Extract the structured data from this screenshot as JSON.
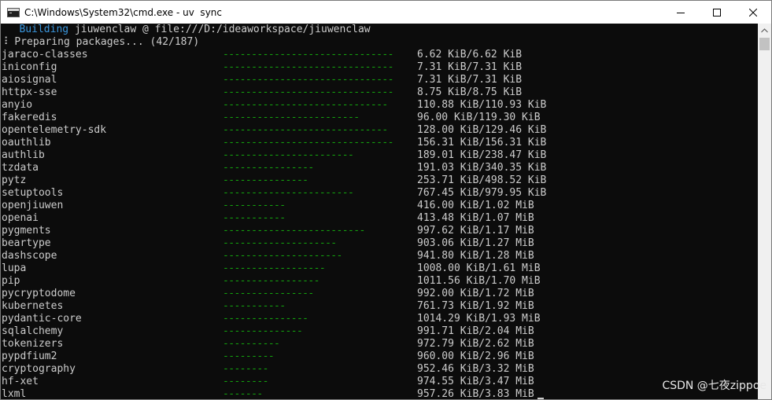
{
  "window": {
    "title": "C:\\Windows\\System32\\cmd.exe - uv  sync",
    "icon": "cmd-icon",
    "controls": [
      "minimize-icon",
      "maximize-icon",
      "close-icon"
    ]
  },
  "console": {
    "header": {
      "building_label": "Building",
      "building_target": "jiuwenclaw @ file:///D:/ideaworkspace/jiuwenclaw",
      "preparing": "⠸ Preparing packages... (42/187)"
    },
    "packages": [
      {
        "name": "jaraco-classes",
        "progress": 1.0,
        "size": "6.62 KiB/6.62 KiB"
      },
      {
        "name": "iniconfig",
        "progress": 1.0,
        "size": "7.31 KiB/7.31 KiB"
      },
      {
        "name": "aiosignal",
        "progress": 1.0,
        "size": "7.31 KiB/7.31 KiB"
      },
      {
        "name": "httpx-sse",
        "progress": 1.0,
        "size": "8.75 KiB/8.75 KiB"
      },
      {
        "name": "anyio",
        "progress": 0.97,
        "size": "110.88 KiB/110.93 KiB"
      },
      {
        "name": "fakeredis",
        "progress": 0.8,
        "size": "96.00 KiB/119.30 KiB"
      },
      {
        "name": "opentelemetry-sdk",
        "progress": 0.97,
        "size": "128.00 KiB/129.46 KiB"
      },
      {
        "name": "oauthlib",
        "progress": 1.0,
        "size": "156.31 KiB/156.31 KiB"
      },
      {
        "name": "authlib",
        "progress": 0.77,
        "size": "189.01 KiB/238.47 KiB"
      },
      {
        "name": "tzdata",
        "progress": 0.53,
        "size": "191.03 KiB/340.35 KiB"
      },
      {
        "name": "pytz",
        "progress": 0.5,
        "size": "253.71 KiB/498.52 KiB"
      },
      {
        "name": "setuptools",
        "progress": 0.77,
        "size": "767.45 KiB/979.95 KiB"
      },
      {
        "name": "openjiuwen",
        "progress": 0.37,
        "size": "416.00 KiB/1.02 MiB"
      },
      {
        "name": "openai",
        "progress": 0.37,
        "size": "413.48 KiB/1.07 MiB"
      },
      {
        "name": "pygments",
        "progress": 0.83,
        "size": "997.62 KiB/1.17 MiB"
      },
      {
        "name": "beartype",
        "progress": 0.67,
        "size": "903.06 KiB/1.27 MiB"
      },
      {
        "name": "dashscope",
        "progress": 0.7,
        "size": "941.80 KiB/1.28 MiB"
      },
      {
        "name": "lupa",
        "progress": 0.6,
        "size": "1008.00 KiB/1.61 MiB"
      },
      {
        "name": "pip",
        "progress": 0.57,
        "size": "1011.56 KiB/1.70 MiB"
      },
      {
        "name": "pycryptodome",
        "progress": 0.53,
        "size": "992.00 KiB/1.72 MiB"
      },
      {
        "name": "kubernetes",
        "progress": 0.37,
        "size": "761.73 KiB/1.92 MiB"
      },
      {
        "name": "pydantic-core",
        "progress": 0.5,
        "size": "1014.29 KiB/1.93 MiB"
      },
      {
        "name": "sqlalchemy",
        "progress": 0.47,
        "size": "991.71 KiB/2.04 MiB"
      },
      {
        "name": "tokenizers",
        "progress": 0.33,
        "size": "972.79 KiB/2.62 MiB"
      },
      {
        "name": "pypdfium2",
        "progress": 0.3,
        "size": "960.00 KiB/2.96 MiB"
      },
      {
        "name": "cryptography",
        "progress": 0.27,
        "size": "952.46 KiB/3.32 MiB"
      },
      {
        "name": "hf-xet",
        "progress": 0.27,
        "size": "974.55 KiB/3.47 MiB"
      },
      {
        "name": "lxml",
        "progress": 0.23,
        "size": "957.26 KiB/3.83 MiB"
      }
    ]
  },
  "watermark": "CSDN @七夜zippoe",
  "colors": {
    "background": "#0c0c0c",
    "text": "#cccccc",
    "building": "#3a96dd",
    "progress_bar": "#13a10e"
  }
}
